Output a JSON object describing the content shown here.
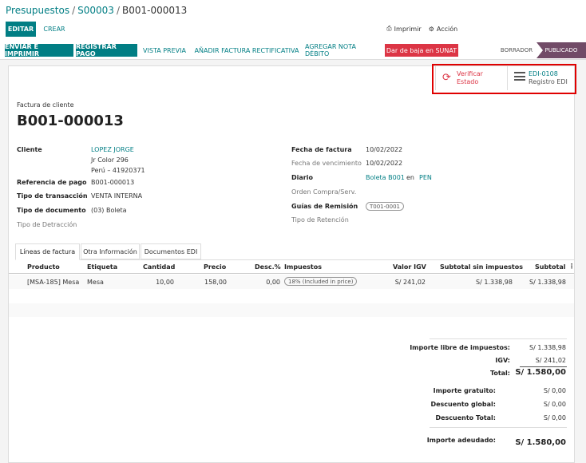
{
  "breadcrumb": {
    "part1": "Presupuestos",
    "part2": "S00003",
    "current": "B001-000013"
  },
  "toolbar": {
    "edit": "EDITAR",
    "create": "CREAR",
    "print": "Imprimir",
    "action": "Acción"
  },
  "actions": {
    "send_print": "ENVIAR E IMPRIMIR",
    "register_payment": "REGISTRAR PAGO",
    "preview": "VISTA PREVIA",
    "add_rectifying": "AÑADIR FACTURA RECTIFICATIVA",
    "add_debit_note": "AGREGAR NOTA DÉBITO",
    "sunat_cancel": "Dar de baja en SUNAT"
  },
  "status": {
    "draft": "BORRADOR",
    "published": "PUBLICADO"
  },
  "smart_buttons": {
    "verify_line1": "Verificar",
    "verify_line2": "Estado",
    "edi_line1": "EDI-0108",
    "edi_line2": "Registro EDI"
  },
  "invoice": {
    "type": "Factura de cliente",
    "number": "B001-000013",
    "customer_label": "Cliente",
    "customer_name": "LOPEZ JORGE",
    "customer_addr1": "Jr Color 296",
    "customer_addr2": "Perú – 41920371",
    "payment_ref_label": "Referencia de pago",
    "payment_ref": "B001-000013",
    "transaction_type_label": "Tipo de transacción",
    "transaction_type": "VENTA INTERNA",
    "doc_type_label": "Tipo de documento",
    "doc_type": "(03) Boleta",
    "detraction_label": "Tipo de Detracción",
    "invoice_date_label": "Fecha de factura",
    "invoice_date": "10/02/2022",
    "due_date_label": "Fecha de vencimiento",
    "due_date": "10/02/2022",
    "journal_label": "Diario",
    "journal": "Boleta B001",
    "journal_in": "en",
    "currency": "PEN",
    "po_label": "Orden Compra/Serv.",
    "guides_label": "Guías de Remisión",
    "guide_tag": "T001-0001",
    "retention_label": "Tipo de Retención"
  },
  "tabs": [
    "Líneas de factura",
    "Otra Información",
    "Documentos EDI"
  ],
  "table": {
    "headers": [
      "Producto",
      "Etiqueta",
      "Cantidad",
      "Precio",
      "Desc.%",
      "Impuestos",
      "Valor IGV",
      "Subtotal sin impuestos",
      "Subtotal"
    ],
    "rows": [
      [
        "[MSA-185] Mesa",
        "Mesa",
        "10,00",
        "158,00",
        "0,00",
        "18% (Included in price)",
        "S/ 241,02",
        "S/ 1.338,98",
        "S/ 1.338,98"
      ]
    ]
  },
  "totals": {
    "untaxed_label": "Importe libre de impuestos:",
    "untaxed": "S/ 1.338,98",
    "igv_label": "IGV:",
    "igv": "S/ 241,02",
    "total_label": "Total:",
    "total": "S/ 1.580,00",
    "free_label": "Importe gratuito:",
    "free": "S/ 0,00",
    "global_disc_label": "Descuento global:",
    "global_disc": "S/ 0,00",
    "total_disc_label": "Descuento Total:",
    "total_disc": "S/ 0,00",
    "due_label": "Importe adeudado:",
    "due": "S/ 1.580,00"
  },
  "colors": {
    "primary": "#017e84",
    "danger": "#dc3545",
    "status_active": "#714b67",
    "highlight": "#e00000"
  }
}
